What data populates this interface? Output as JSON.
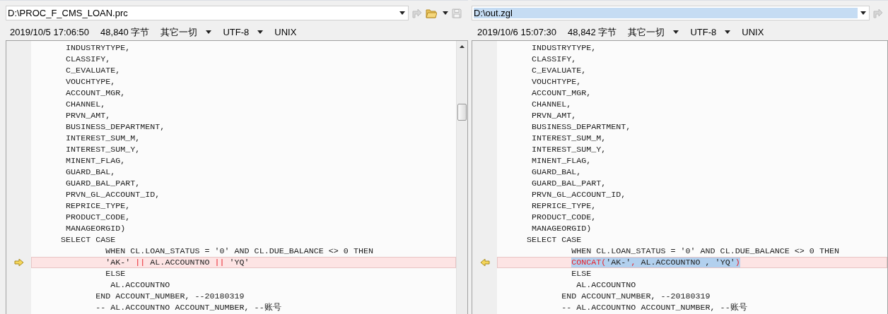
{
  "panes": [
    {
      "path": "D:\\PROC_F_CMS_LOAN.prc",
      "path_selected": false,
      "modified": "2019/10/5 17:06:50",
      "size": "48,840 字节",
      "filter": "其它一切",
      "encoding": "UTF-8",
      "line_endings": "UNIX",
      "marker_points_right": true,
      "lines": [
        {
          "kind": "same",
          "text": "       INDUSTRYTYPE,"
        },
        {
          "kind": "same",
          "text": "       CLASSIFY,"
        },
        {
          "kind": "same",
          "text": "       C_EVALUATE,"
        },
        {
          "kind": "same",
          "text": "       VOUCHTYPE,"
        },
        {
          "kind": "same",
          "text": "       ACCOUNT_MGR,"
        },
        {
          "kind": "same",
          "text": "       CHANNEL,"
        },
        {
          "kind": "same",
          "text": "       PRVN_AMT,"
        },
        {
          "kind": "same",
          "text": "       BUSINESS_DEPARTMENT,"
        },
        {
          "kind": "same",
          "text": "       INTEREST_SUM_M,"
        },
        {
          "kind": "same",
          "text": "       INTEREST_SUM_Y,"
        },
        {
          "kind": "same",
          "text": "       MINENT_FLAG,"
        },
        {
          "kind": "same",
          "text": "       GUARD_BAL,"
        },
        {
          "kind": "same",
          "text": "       GUARD_BAL_PART,"
        },
        {
          "kind": "same",
          "text": "       PRVN_GL_ACCOUNT_ID,"
        },
        {
          "kind": "same",
          "text": "       REPRICE_TYPE,"
        },
        {
          "kind": "same",
          "text": "       PRODUCT_CODE,"
        },
        {
          "kind": "same",
          "text": "       MANAGEORGID)"
        },
        {
          "kind": "same",
          "text": "      SELECT CASE"
        },
        {
          "kind": "same",
          "text": "               WHEN CL.LOAN_STATUS = '0' AND CL.DUE_BALANCE <> 0 THEN"
        },
        {
          "kind": "changed",
          "segments": [
            {
              "text": "'AK-' ",
              "changed": false,
              "selected": false
            },
            {
              "text": "||",
              "changed": true,
              "selected": false
            },
            {
              "text": " AL.ACCOUNTNO ",
              "changed": false,
              "selected": false
            },
            {
              "text": "||",
              "changed": true,
              "selected": false
            },
            {
              "text": " 'YQ'",
              "changed": false,
              "selected": false
            }
          ]
        },
        {
          "kind": "same",
          "text": "               ELSE"
        },
        {
          "kind": "same",
          "text": "                AL.ACCOUNTNO"
        },
        {
          "kind": "same",
          "text": "             END ACCOUNT_NUMBER, --20180319"
        },
        {
          "kind": "same",
          "text": "             -- AL.ACCOUNTNO ACCOUNT_NUMBER, --账号"
        }
      ]
    },
    {
      "path": "D:\\out.zgl",
      "path_selected": true,
      "modified": "2019/10/6 15:07:30",
      "size": "48,842 字节",
      "filter": "其它一切",
      "encoding": "UTF-8",
      "line_endings": "UNIX",
      "marker_points_right": false,
      "lines": [
        {
          "kind": "same",
          "text": "       INDUSTRYTYPE,"
        },
        {
          "kind": "same",
          "text": "       CLASSIFY,"
        },
        {
          "kind": "same",
          "text": "       C_EVALUATE,"
        },
        {
          "kind": "same",
          "text": "       VOUCHTYPE,"
        },
        {
          "kind": "same",
          "text": "       ACCOUNT_MGR,"
        },
        {
          "kind": "same",
          "text": "       CHANNEL,"
        },
        {
          "kind": "same",
          "text": "       PRVN_AMT,"
        },
        {
          "kind": "same",
          "text": "       BUSINESS_DEPARTMENT,"
        },
        {
          "kind": "same",
          "text": "       INTEREST_SUM_M,"
        },
        {
          "kind": "same",
          "text": "       INTEREST_SUM_Y,"
        },
        {
          "kind": "same",
          "text": "       MINENT_FLAG,"
        },
        {
          "kind": "same",
          "text": "       GUARD_BAL,"
        },
        {
          "kind": "same",
          "text": "       GUARD_BAL_PART,"
        },
        {
          "kind": "same",
          "text": "       PRVN_GL_ACCOUNT_ID,"
        },
        {
          "kind": "same",
          "text": "       REPRICE_TYPE,"
        },
        {
          "kind": "same",
          "text": "       PRODUCT_CODE,"
        },
        {
          "kind": "same",
          "text": "       MANAGEORGID)"
        },
        {
          "kind": "same",
          "text": "      SELECT CASE"
        },
        {
          "kind": "same",
          "text": "               WHEN CL.LOAN_STATUS = '0' AND CL.DUE_BALANCE <> 0 THEN"
        },
        {
          "kind": "changed",
          "segments": [
            {
              "text": "CONCAT(",
              "changed": true,
              "selected": true
            },
            {
              "text": "'AK-'",
              "changed": false,
              "selected": true
            },
            {
              "text": ",",
              "changed": true,
              "selected": true
            },
            {
              "text": " AL.ACCOUNTNO , 'YQ'",
              "changed": false,
              "selected": true
            },
            {
              "text": ")",
              "changed": true,
              "selected": true
            }
          ]
        },
        {
          "kind": "same",
          "text": "               ELSE"
        },
        {
          "kind": "same",
          "text": "                AL.ACCOUNTNO"
        },
        {
          "kind": "same",
          "text": "             END ACCOUNT_NUMBER, --20180319"
        },
        {
          "kind": "same",
          "text": "             -- AL.ACCOUNTNO ACCOUNT_NUMBER, --账号"
        }
      ]
    }
  ]
}
